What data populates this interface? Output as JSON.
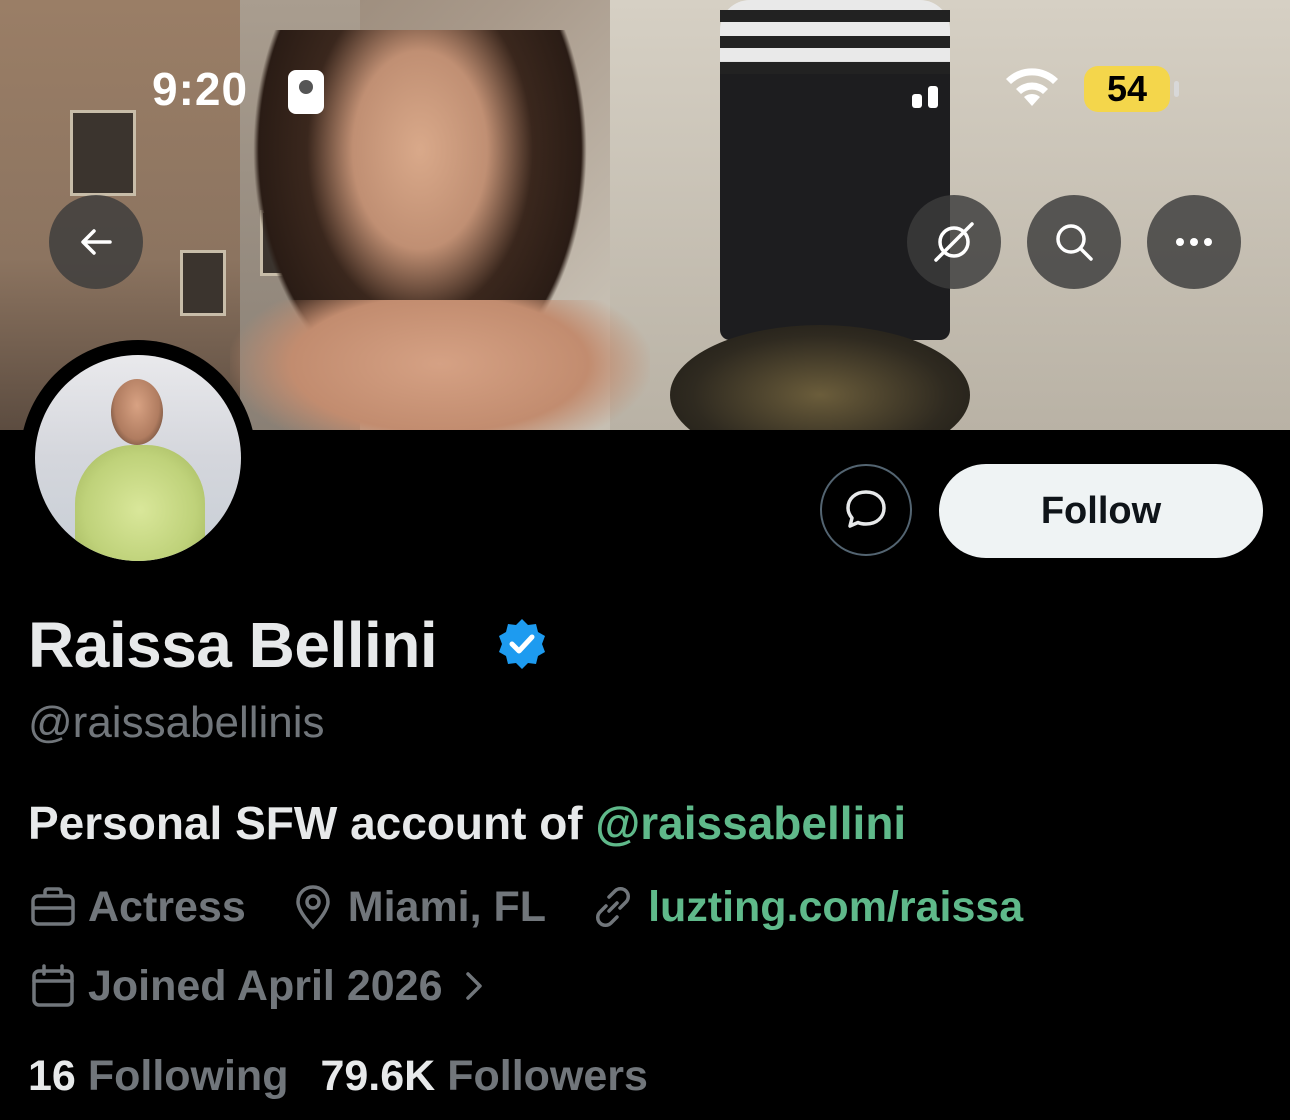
{
  "status_bar": {
    "time": "9:20",
    "battery": "54"
  },
  "profile": {
    "name": "Raissa Bellini",
    "handle": "@raissabellinis",
    "bio_text": "Personal SFW account of ",
    "bio_mention": "@raissabellini",
    "profession": "Actress",
    "location": "Miami, FL",
    "website": "luzting.com/raissa",
    "joined": "Joined April 2026",
    "following_count": "16",
    "following_label": "Following",
    "followers_count": "79.6K",
    "followers_label": "Followers"
  },
  "actions": {
    "follow_label": "Follow"
  },
  "icons": {
    "back": "back-arrow-icon",
    "grok": "grok-icon",
    "search": "search-icon",
    "more": "more-icon",
    "message": "message-icon",
    "verified": "verified-badge-icon",
    "briefcase": "briefcase-icon",
    "location": "location-pin-icon",
    "link": "link-icon",
    "calendar": "calendar-icon",
    "chevron": "chevron-right-icon"
  },
  "colors": {
    "accent_link": "#5fb98a",
    "verified": "#1d9bf0",
    "muted": "#71767b",
    "battery": "#f4d64b"
  }
}
